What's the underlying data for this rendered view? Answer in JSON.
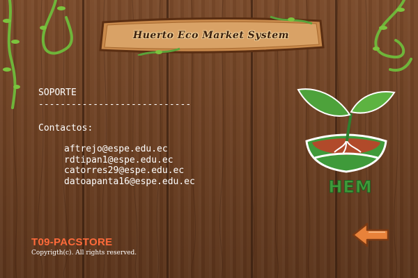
{
  "header": {
    "title": "Huerto Eco Market System"
  },
  "support": {
    "heading": "SOPORTE",
    "divider": "----------------------------",
    "contacts_label": "Contactos:",
    "emails": [
      "aftrejo@espe.edu.ec",
      "rdtipan1@espe.edu.ec",
      "catorres29@espe.edu.ec",
      "datoapanta16@espe.edu.ec"
    ]
  },
  "footer": {
    "brand": "T09-PACSTORE",
    "copyright": "Copyrigth(c). All rights reserved."
  },
  "logo": {
    "text": "HEM",
    "icon": "plant-bowl-logo"
  },
  "colors": {
    "wood": "#6b3f22",
    "leaf_green": "#4da23b",
    "brand_orange": "#ff6a3a",
    "arrow_orange": "#e8823a"
  },
  "icons": {
    "back": "back-arrow-icon",
    "vine": "vine-decoration"
  }
}
